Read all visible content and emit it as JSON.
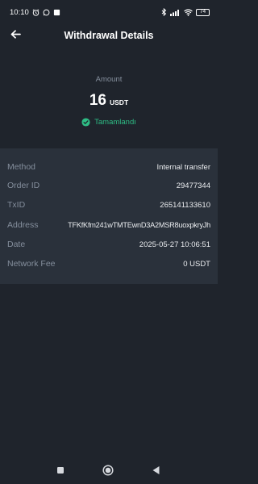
{
  "status_bar": {
    "time": "10:10",
    "battery": "74",
    "icons": [
      "alarm-icon",
      "whatsapp-icon",
      "notification-icon",
      "bluetooth-icon",
      "signal-icon",
      "wifi-icon",
      "battery-icon"
    ]
  },
  "header": {
    "title": "Withdrawal Details",
    "back_icon": "arrow-left-icon"
  },
  "summary": {
    "amount_label": "Amount",
    "amount_value": "16",
    "amount_unit": "USDT",
    "status": "Tamamlandı",
    "status_icon": "check-circle-icon"
  },
  "details": {
    "method": {
      "label": "Method",
      "value": "Internal transfer"
    },
    "order_id": {
      "label": "Order ID",
      "value": "29477344"
    },
    "txid": {
      "label": "TxID",
      "value": "265141133610"
    },
    "address": {
      "label": "Address",
      "value": "TFKfKfm241wTMTEwnD3A2MSR8uoxpkryJh"
    },
    "date": {
      "label": "Date",
      "value": "2025-05-27 10:06:51"
    },
    "network_fee": {
      "label": "Network Fee",
      "value": "0 USDT"
    }
  },
  "nav_bar": {
    "icons": [
      "recents-square-icon",
      "home-circle-icon",
      "back-triangle-icon"
    ]
  },
  "colors": {
    "background": "#1f242c",
    "card": "#2a313b",
    "success": "#2ebd85",
    "muted": "#848e9c",
    "text": "#eaecef"
  }
}
